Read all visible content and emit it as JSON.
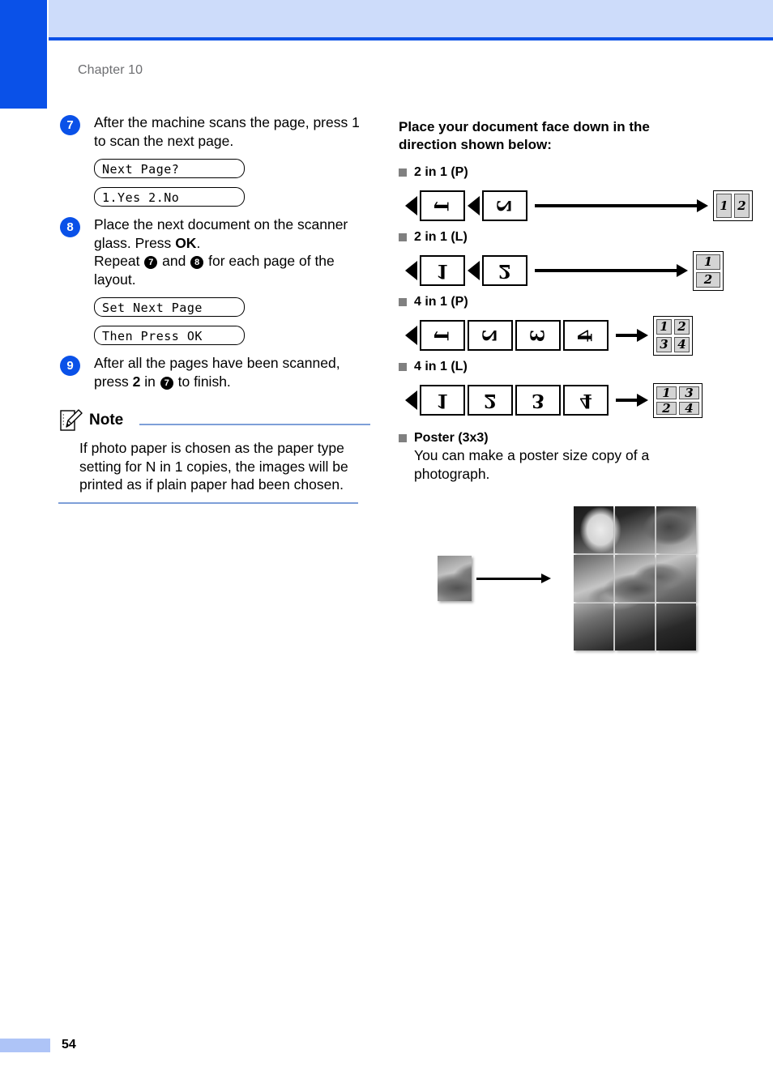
{
  "header": {
    "chapter_label": "Chapter 10"
  },
  "footer": {
    "page_number": "54"
  },
  "left_column": {
    "steps": [
      {
        "number": "7",
        "text_parts": [
          {
            "t": "After the machine scans the page, press 1 to scan the next page.",
            "bold": false
          }
        ],
        "lcd": [
          "Next Page?",
          "1.Yes 2.No"
        ]
      },
      {
        "number": "8",
        "text_parts": [
          {
            "t": "Place the next document on the scanner glass. Press ",
            "bold": false
          },
          {
            "t": "OK",
            "bold": true
          },
          {
            "t": ".",
            "bold": false
          },
          {
            "t": "Repeat ",
            "bold": false,
            "newline": true
          },
          {
            "t": "7",
            "circle": true
          },
          {
            "t": " and ",
            "bold": false
          },
          {
            "t": "8",
            "circle": true
          },
          {
            "t": " for each page of the layout.",
            "bold": false
          }
        ],
        "lcd": [
          "Set Next Page",
          "Then Press OK"
        ]
      },
      {
        "number": "9",
        "text_parts": [
          {
            "t": "After all the pages have been scanned, press ",
            "bold": false
          },
          {
            "t": "2",
            "bold": true
          },
          {
            "t": " in ",
            "bold": false
          },
          {
            "t": "7",
            "circle": true
          },
          {
            "t": " to finish.",
            "bold": false
          }
        ],
        "lcd": []
      }
    ],
    "note": {
      "icon": "note-pencil-icon",
      "title": "Note",
      "body": "If photo paper is chosen as the paper type setting for N in 1 copies, the images will be printed as if plain paper had been chosen."
    }
  },
  "right_column": {
    "heading": "Place your document face down in the direction shown below:",
    "layouts": [
      {
        "label": "2 in 1 (P)",
        "orientation": "portrait-source",
        "pages": [
          "1",
          "2"
        ],
        "arrow": "long",
        "result_class": "res-2p",
        "result_cells": [
          "1",
          "2"
        ]
      },
      {
        "label": "2 in 1 (L)",
        "orientation": "landscape-source",
        "pages": [
          "1",
          "2"
        ],
        "arrow": "mid",
        "result_class": "res-2l",
        "result_cells": [
          "1",
          "2"
        ]
      },
      {
        "label": "4 in 1 (P)",
        "orientation": "portrait-source",
        "pages": [
          "1",
          "2",
          "3",
          "4"
        ],
        "arrow": "short",
        "result_class": "res-4p",
        "result_cells": [
          "1",
          "2",
          "3",
          "4"
        ]
      },
      {
        "label": "4 in 1 (L)",
        "orientation": "landscape-source",
        "pages": [
          "1",
          "2",
          "3",
          "4"
        ],
        "arrow": "short",
        "result_class": "res-4l",
        "result_cells": [
          "1",
          "3",
          "2",
          "4"
        ]
      }
    ],
    "poster": {
      "label": "Poster (3x3)",
      "description": "You can make a poster size copy of a photograph.",
      "figure_alt": "handshake-photograph",
      "grid": "3x3"
    }
  },
  "colors": {
    "accent_blue": "#0a51e8",
    "header_band": "#cddcfa",
    "footer_bar": "#aec4f7",
    "note_rule": "#7e9fd8",
    "bullet_gray": "#808080",
    "result_cell": "#d4d4d4"
  }
}
